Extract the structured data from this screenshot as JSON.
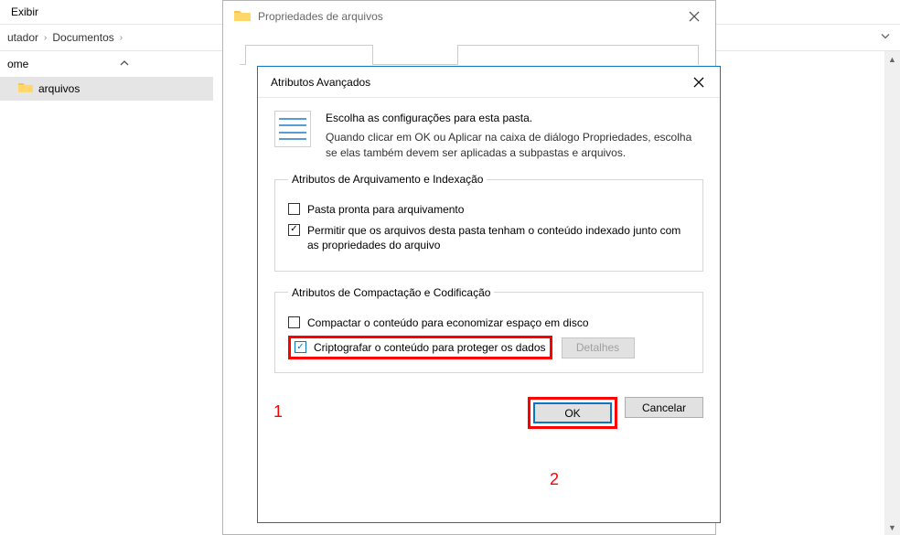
{
  "menu": {
    "view": "Exibir"
  },
  "breadcrumb": {
    "item1": "utador",
    "item2": "Documentos"
  },
  "nav": {
    "label": "ome"
  },
  "sidebar": {
    "items": [
      {
        "label": "arquivos"
      }
    ]
  },
  "properties": {
    "title": "Propriedades de arquivos",
    "tabs": {
      "hint1": "",
      "hint2": ""
    }
  },
  "advanced": {
    "title": "Atributos Avançados",
    "intro_title": "Escolha as configurações para esta pasta.",
    "intro_desc": "Quando clicar em OK ou Aplicar na caixa de diálogo Propriedades, escolha se elas também devem ser aplicadas a subpastas e arquivos.",
    "group1": {
      "legend": "Atributos de Arquivamento e Indexação",
      "cb1_label": "Pasta pronta para arquivamento",
      "cb2_label": "Permitir que os arquivos desta pasta tenham o conteúdo indexado junto com as propriedades do arquivo"
    },
    "group2": {
      "legend": "Atributos de Compactação e Codificação",
      "cb3_label": "Compactar o conteúdo para economizar espaço em disco",
      "cb4_label": "Criptografar o conteúdo para proteger os dados",
      "details_btn": "Detalhes"
    },
    "buttons": {
      "ok": "OK",
      "cancel": "Cancelar"
    }
  },
  "annotations": {
    "one": "1",
    "two": "2"
  }
}
